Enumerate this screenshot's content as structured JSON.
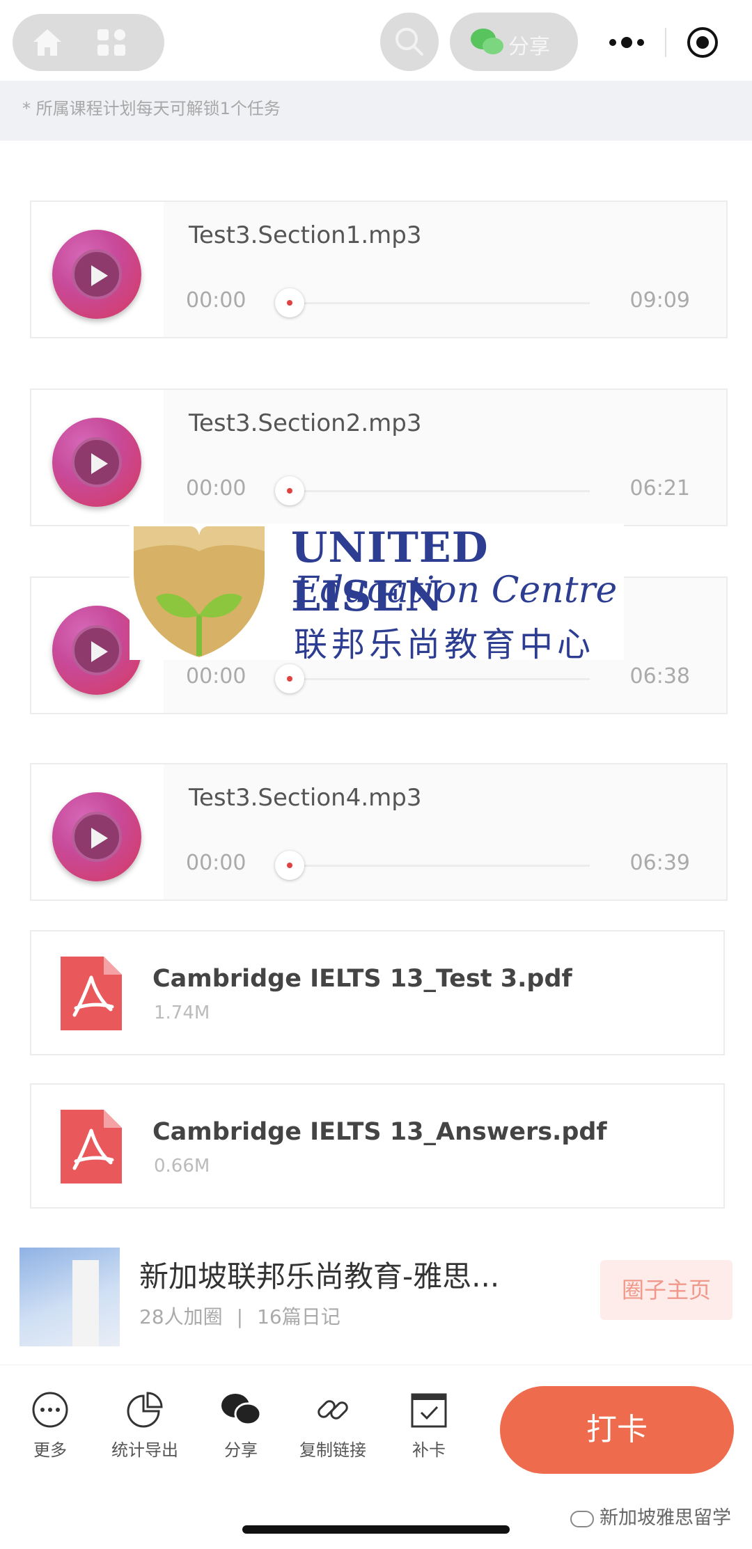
{
  "header": {
    "share_label": "分享"
  },
  "notice": "* 所属课程计划每天可解锁1个任务",
  "audio_files": [
    {
      "name": "Test3.Section1.mp3",
      "current": "00:00",
      "duration": "09:09"
    },
    {
      "name": "Test3.Section2.mp3",
      "current": "00:00",
      "duration": "06:21"
    },
    {
      "name": "",
      "current": "00:00",
      "duration": "06:38"
    },
    {
      "name": "Test3.Section4.mp3",
      "current": "00:00",
      "duration": "06:39"
    }
  ],
  "pdf_files": [
    {
      "name": "Cambridge IELTS 13_Test 3.pdf",
      "size": "1.74M"
    },
    {
      "name": "Cambridge IELTS 13_Answers.pdf",
      "size": "0.66M"
    }
  ],
  "logo": {
    "line1": "UNITED LISEN",
    "line2": "Education Centre",
    "line3": "联邦乐尚教育中心"
  },
  "circle": {
    "title": "新加坡联邦乐尚教育-雅思...",
    "members": "28人加圈",
    "separator": "|",
    "diaries": "16篇日记",
    "home_button": "圈子主页"
  },
  "toolbar": {
    "more": "更多",
    "stats": "统计导出",
    "share": "分享",
    "copy_link": "复制链接",
    "makeup": "补卡",
    "checkin": "打卡"
  },
  "watermark": "新加坡雅思留学",
  "colors": {
    "accent": "#ee6c4d",
    "logo_blue": "#2d3d91",
    "pdf_red": "#e9585a"
  }
}
